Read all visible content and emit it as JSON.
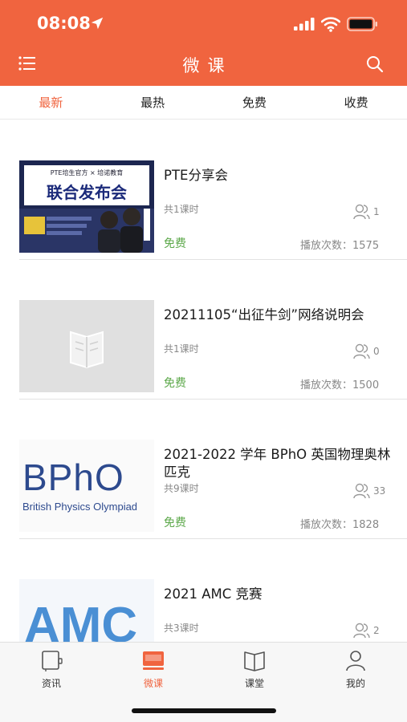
{
  "status": {
    "time": "08:08"
  },
  "header": {
    "title": "微课"
  },
  "tabs": [
    {
      "label": "最新",
      "active": true
    },
    {
      "label": "最热",
      "active": false
    },
    {
      "label": "免费",
      "active": false
    },
    {
      "label": "收费",
      "active": false
    }
  ],
  "courses": [
    {
      "title": "PTE分享会",
      "lessons": "共1课时",
      "users": "1",
      "price": "免费",
      "plays": "播放次数：1575",
      "thumb_text": {
        "top": "PTE培生官方 × 培诺教育",
        "main": "联合发布会"
      }
    },
    {
      "title": "20211105“出征牛剑”网络说明会",
      "lessons": "共1课时",
      "users": "0",
      "price": "免费",
      "plays": "播放次数：1500"
    },
    {
      "title": "2021-2022 学年 BPhO 英国物理奥林匹克",
      "lessons": "共9课时",
      "users": "33",
      "price": "免费",
      "plays": "播放次数：1828",
      "thumb_text": {
        "logo": "BPhO",
        "sub": "British Physics Olympiad"
      }
    },
    {
      "title": "2021 AMC 竞赛",
      "lessons": "共3课时",
      "users": "2",
      "price": "",
      "plays": "",
      "thumb_text": {
        "logo": "AMC"
      }
    }
  ],
  "tabbar": [
    {
      "label": "资讯",
      "icon": "news-icon",
      "active": false
    },
    {
      "label": "微课",
      "icon": "micro-course-icon",
      "active": true
    },
    {
      "label": "课堂",
      "icon": "book-icon",
      "active": false
    },
    {
      "label": "我的",
      "icon": "profile-icon",
      "active": false
    }
  ],
  "colors": {
    "accent": "#f0643f",
    "free": "#5ca84a"
  }
}
